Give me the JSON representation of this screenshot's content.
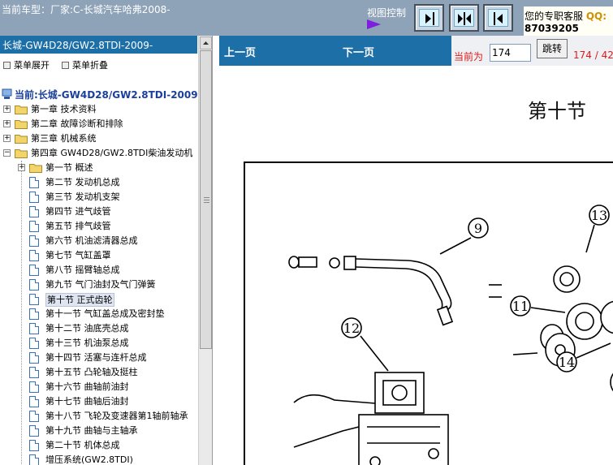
{
  "top": {
    "car_label": "当前车型：厂家:C-长城汽车哈弗2008-",
    "view_control_label": "视图控制",
    "service_line1": "您的专职客服",
    "qq_label": "QQ:",
    "service_line2": "87039205"
  },
  "sidebar": {
    "title": "长城-GW4D28/GW2.8TDI-2009-",
    "expand_label": "菜单展开",
    "collapse_label": "菜单折叠",
    "current_label": "当前:长城-GW4D28/GW2.8TDI-2009-",
    "chapters": [
      "第一章 技术资料",
      "第二章 故障诊断和排除",
      "第三章 机械系统",
      "第四章 GW4D28/GW2.8TDI柴油发动机"
    ],
    "sections": [
      "第一节 概述",
      "第二节 发动机总成",
      "第三节 发动机支架",
      "第四节 进气歧管",
      "第五节 排气歧管",
      "第六节 机油滤清器总成",
      "第七节 气缸盖罩",
      "第八节 摇臂轴总成",
      "第九节 气门油封及气门弹簧",
      "第十节 正式齿轮",
      "第十一节 气缸盖总成及密封垫",
      "第十二节 油底壳总成",
      "第十三节 机油泵总成",
      "第十四节 活塞与连杆总成",
      "第十五节 凸轮轴及挺柱",
      "第十六节 曲轴前油封",
      "第十七节 曲轴后油封",
      "第十八节 飞轮及变速器第1轴前轴承",
      "第十九节 曲轴与主轴承",
      "第二十节 机体总成",
      "增压系统(GW2.8TDI)"
    ]
  },
  "nav": {
    "prev_label": "上一页",
    "next_label": "下一页",
    "current_prefix": "当前为",
    "page_value": "174",
    "jump_label": "跳转",
    "page_count": "174 / 422"
  },
  "content": {
    "heading": "第十节",
    "callouts": [
      "9",
      "12",
      "11",
      "13",
      "14"
    ]
  },
  "colors": {
    "top_bar": "#8ea3b8",
    "panel_blue": "#1d6fa8",
    "accent_red": "#e01a1a",
    "view_arrow": "#7e1ee0"
  }
}
